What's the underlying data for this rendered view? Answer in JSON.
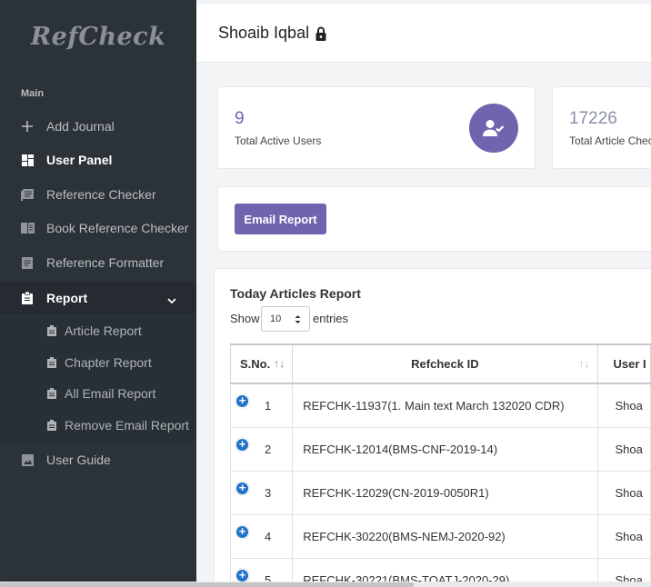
{
  "app": {
    "logo": "RefCheck"
  },
  "sidebar": {
    "section_label": "Main",
    "items": [
      {
        "label": "Add Journal",
        "icon": "plus-icon"
      },
      {
        "label": "User Panel",
        "icon": "dashboard-icon"
      },
      {
        "label": "Reference Checker",
        "icon": "document-list-icon"
      },
      {
        "label": "Book Reference Checker",
        "icon": "book-icon"
      },
      {
        "label": "Reference Formatter",
        "icon": "file-text-icon"
      },
      {
        "label": "Report",
        "icon": "clipboard-icon"
      },
      {
        "label": "User Guide",
        "icon": "image-guide-icon"
      }
    ],
    "report_subitems": [
      {
        "label": "Article Report"
      },
      {
        "label": "Chapter Report"
      },
      {
        "label": "All Email Report"
      },
      {
        "label": "Remove Email Report"
      }
    ]
  },
  "header": {
    "user_name": "Shoaib Iqbal"
  },
  "stats": [
    {
      "value": "9",
      "label": "Total Active Users"
    },
    {
      "value": "17226",
      "label": "Total Article Chec"
    }
  ],
  "actions": {
    "email_report": "Email Report"
  },
  "report": {
    "title": "Today Articles Report",
    "show_label": "Show",
    "page_size": "10",
    "entries_label": "entries",
    "columns": [
      "S.No.",
      "Refcheck ID",
      "User I"
    ],
    "rows": [
      {
        "sno": "1",
        "id": "REFCHK-11937(1. Main text March 132020 CDR)",
        "user": "Shoa"
      },
      {
        "sno": "2",
        "id": "REFCHK-12014(BMS-CNF-2019-14)",
        "user": "Shoa"
      },
      {
        "sno": "3",
        "id": "REFCHK-12029(CN-2019-0050R1)",
        "user": "Shoa"
      },
      {
        "sno": "4",
        "id": "REFCHK-30220(BMS-NEMJ-2020-92)",
        "user": "Shoa"
      },
      {
        "sno": "5",
        "id": "REFCHK-30221(BMS-TOATJ-2020-29)",
        "user": "Shoa"
      }
    ]
  },
  "colors": {
    "sidebar_bg": "#2c3338",
    "accent": "#6f64ae",
    "expand_icon": "#1f73c8"
  }
}
